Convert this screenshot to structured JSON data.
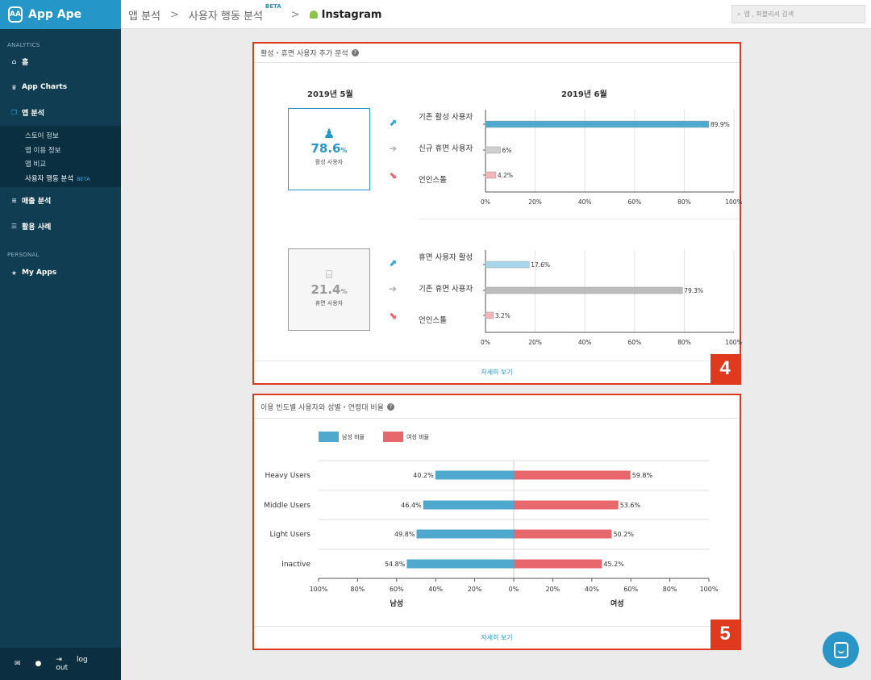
{
  "sidebar": {
    "brand": "App Ape",
    "brand_mark": "AA",
    "section_analytics": "ANALYTICS",
    "home": "홈",
    "app_charts": "App Charts",
    "app_analysis": "앱 분석",
    "sub": [
      "스토어 정보",
      "앱 이용 정보",
      "앱 비교",
      "사용자 행동 분석"
    ],
    "sub_beta": "BETA",
    "sales": "매출 분석",
    "cases": "활용 사례",
    "section_personal": "PERSONAL",
    "my_apps": "My Apps",
    "logout": "log out",
    "icons": [
      "home-icon",
      "trophy-icon",
      "copy-icon",
      "database-icon",
      "list-icon",
      "star-icon",
      "mail-icon",
      "user-icon",
      "logout-icon"
    ]
  },
  "topbar": {
    "crumb1": "앱 분석",
    "crumb2": "사용자 행동 분석",
    "crumb2_badge": "BETA",
    "app": "Instagram",
    "sep": ">",
    "search_placeholder": "앱 , 퍼블리셔 검색"
  },
  "card4": {
    "title": "활성・휴면 사용자 추가 분석",
    "help": "?",
    "month_prev": "2019년 5월",
    "month_next": "2019년 6월",
    "more": "자세히 보기",
    "badge": "4",
    "active": {
      "pct": "78.6",
      "unit": "%",
      "label": "활성 사용자",
      "rows": [
        "기존 활성 사용자",
        "신규 휴면 사용자",
        "언인스톨"
      ]
    },
    "dormant": {
      "pct": "21.4",
      "unit": "%",
      "label": "휴면 사용자",
      "rows": [
        "휴면 사용자 활성",
        "기존 휴면 사용자",
        "언인스톨"
      ]
    }
  },
  "card5": {
    "title": "이용 빈도별 사용자와 성별・연령대 비율",
    "help": "?",
    "legend_male": "남성 비율",
    "legend_female": "여성 비율",
    "xlabel_left": "남성",
    "xlabel_right": "여성",
    "more": "자세히 보기",
    "badge": "5"
  },
  "colors": {
    "male": "#4fa9cf",
    "female": "#e8676c",
    "active_accent": "#2596c8",
    "badge": "#e03a1e"
  },
  "chart_data": [
    {
      "type": "bar",
      "orientation": "horizontal",
      "categories": [
        "기존 활성 사용자",
        "신규 휴면 사용자",
        "언인스톨"
      ],
      "values": [
        89.9,
        6,
        4.2
      ],
      "value_labels": [
        "89.9%",
        "6%",
        "4.2%"
      ],
      "colors": [
        "#4fa9cf",
        "#cfcfcf",
        "#f4b6b8"
      ],
      "xlim": [
        0,
        100
      ],
      "ticks": [
        "0%",
        "20%",
        "40%",
        "60%",
        "80%",
        "100%"
      ]
    },
    {
      "type": "bar",
      "orientation": "horizontal",
      "categories": [
        "휴면 사용자 활성",
        "기존 휴면 사용자",
        "언인스톨"
      ],
      "values": [
        17.6,
        79.3,
        3.2
      ],
      "value_labels": [
        "17.6%",
        "79.3%",
        "3.2%"
      ],
      "colors": [
        "#a8d6ea",
        "#bcbcbc",
        "#f4b6b8"
      ],
      "xlim": [
        0,
        100
      ],
      "ticks": [
        "0%",
        "20%",
        "40%",
        "60%",
        "80%",
        "100%"
      ]
    },
    {
      "type": "bar",
      "orientation": "diverging",
      "categories": [
        "Heavy Users",
        "Middle Users",
        "Light Users",
        "Inactive"
      ],
      "series": [
        {
          "name": "남성 비율",
          "values": [
            40.2,
            46.4,
            49.8,
            54.8
          ],
          "labels": [
            "40.2%",
            "46.4%",
            "49.8%",
            "54.8%"
          ]
        },
        {
          "name": "여성 비율",
          "values": [
            59.8,
            53.6,
            50.2,
            45.2
          ],
          "labels": [
            "59.8%",
            "53.6%",
            "50.2%",
            "45.2%"
          ]
        }
      ],
      "xlim": [
        -100,
        100
      ],
      "ticks": [
        "100%",
        "80%",
        "60%",
        "40%",
        "20%",
        "0%",
        "20%",
        "40%",
        "60%",
        "80%",
        "100%"
      ],
      "xlabel_left": "남성",
      "xlabel_right": "여성"
    }
  ]
}
